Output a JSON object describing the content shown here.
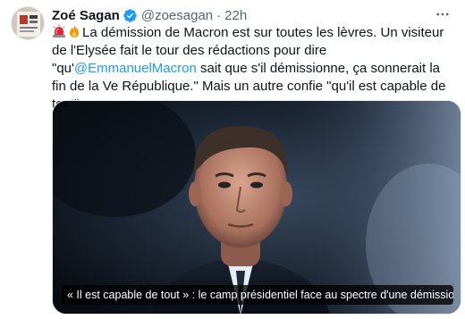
{
  "author": {
    "name": "Zoé Sagan",
    "handle": "@zoesagan",
    "separator": "·",
    "time": "22h",
    "verified_color": "#1d9bf0"
  },
  "tweet": {
    "emojis": [
      "rotating-light-emoji",
      "fire-emoji"
    ],
    "text_before_mention": "La démission de Macron est sur toutes les lèvres. Un visiteur de l'Elysée fait le tour des rédactions pour dire \"qu'",
    "mention": "@EmmanuelMacron",
    "text_after_mention": " sait que s'il démissionne, ça sonnerait la fin de la Ve République.\" Mais un autre confie \"qu'il est capable de tout\"."
  },
  "card": {
    "caption": "« Il est capable de tout » : le camp présidentiel face au spectre d'une démission …"
  },
  "colors": {
    "accent": "#1d9bf0",
    "secondary_text": "#536471",
    "primary_text": "#0f1419"
  },
  "icons": {
    "more": "more-options-icon",
    "verified": "verified-badge-icon"
  }
}
